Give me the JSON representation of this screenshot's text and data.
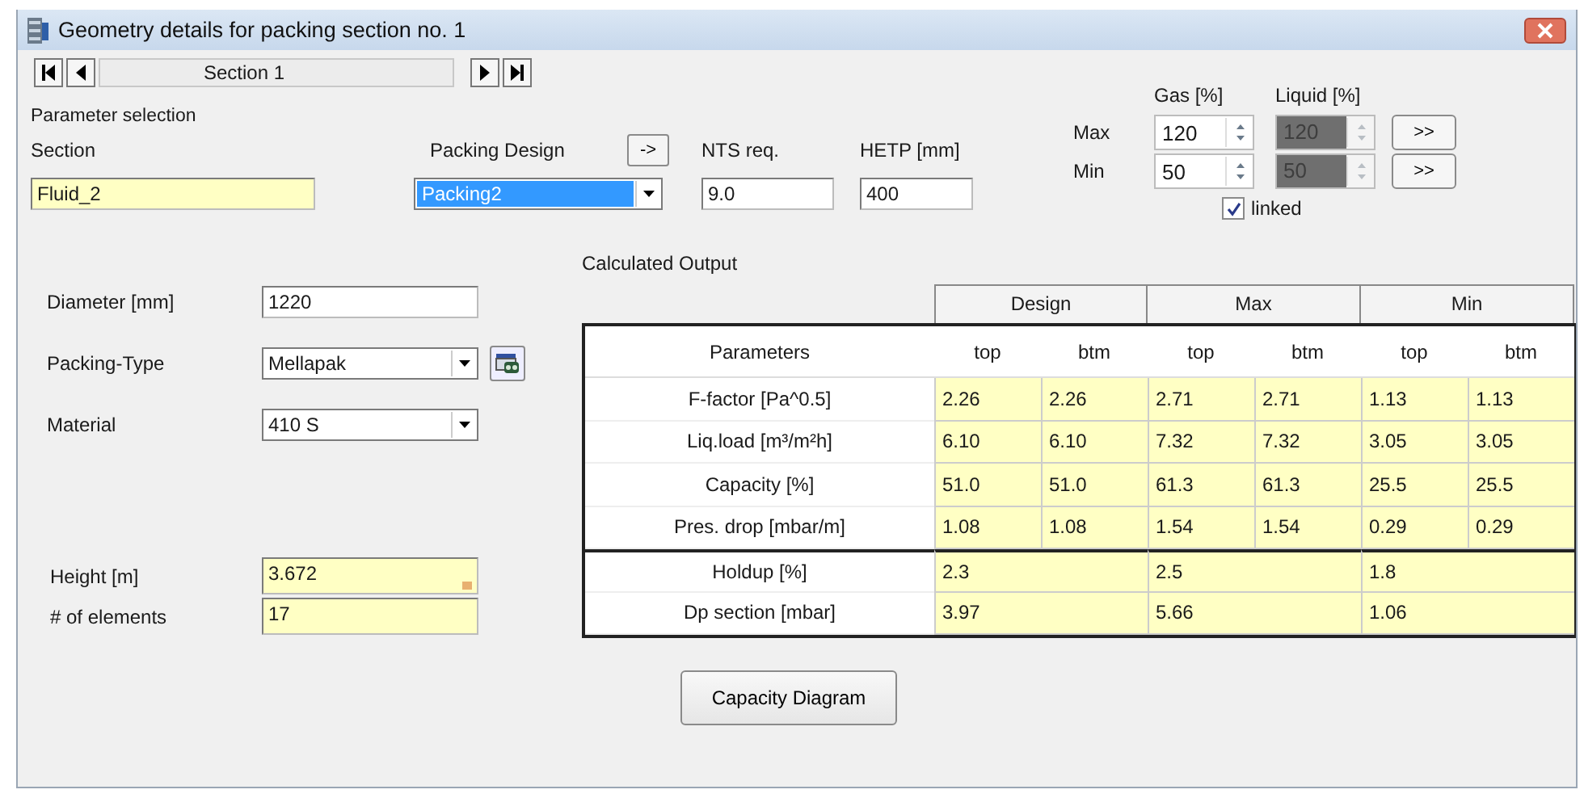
{
  "window": {
    "title": "Geometry details for packing section no. 1"
  },
  "navigator": {
    "section": "Section 1"
  },
  "parameter_selection": {
    "title": "Parameter selection",
    "section": {
      "label": "Section",
      "value": "Fluid_2",
      "highlighted": true
    },
    "packing_design": {
      "label": "Packing Design",
      "value": "Packing2",
      "button": "->",
      "text_selected": true
    },
    "nts_req": {
      "label": "NTS req.",
      "value": "9.0",
      "highlighted": false
    },
    "hetp": {
      "label": "HETP [mm]",
      "value": "400",
      "highlighted": false
    }
  },
  "ranges": {
    "gas_label": "Gas [%]",
    "liquid_label": "Liquid [%]",
    "rows": [
      {
        "label": "Max",
        "gas": "120",
        "liquid": "120",
        "liquid_disabled": true,
        "button": ">>"
      },
      {
        "label": "Min",
        "gas": "50",
        "liquid": "50",
        "liquid_disabled": true,
        "button": ">>"
      }
    ],
    "linked": {
      "label": "linked",
      "checked": true
    }
  },
  "geometry": [
    {
      "kind": "text",
      "label": "Diameter [mm]",
      "value": "1220",
      "highlighted": false
    },
    {
      "kind": "combo",
      "label": "Packing-Type",
      "value": "Mellapak",
      "lookup_button": true
    },
    {
      "kind": "combo",
      "label": "Material",
      "value": "410 S",
      "lookup_button": false
    }
  ],
  "height_fields": [
    {
      "label": "Height [m]",
      "value": "3.672",
      "highlighted": true,
      "marker": true
    },
    {
      "label": "# of elements",
      "value": "17",
      "highlighted": true,
      "marker": false
    }
  ],
  "output": {
    "title": "Calculated Output",
    "groups": [
      "Design",
      "Max",
      "Min"
    ],
    "param_header": "Parameters",
    "sub_headers": [
      "top",
      "btm",
      "top",
      "btm",
      "top",
      "btm"
    ],
    "rows": [
      {
        "label": "F-factor [Pa^0.5]",
        "values": [
          "2.26",
          "2.26",
          "2.71",
          "2.71",
          "1.13",
          "1.13"
        ]
      },
      {
        "label": "Liq.load [m³/m²h]",
        "values": [
          "6.10",
          "6.10",
          "7.32",
          "7.32",
          "3.05",
          "3.05"
        ]
      },
      {
        "label": "Capacity [%]",
        "values": [
          "51.0",
          "51.0",
          "61.3",
          "61.3",
          "25.5",
          "25.5"
        ]
      },
      {
        "label": "Pres. drop [mbar/m]",
        "values": [
          "1.08",
          "1.08",
          "1.54",
          "1.54",
          "0.29",
          "0.29"
        ]
      }
    ],
    "summary_rows": [
      {
        "label": "Holdup [%]",
        "values": [
          "2.3",
          "2.5",
          "1.8"
        ]
      },
      {
        "label": "Dp section [mbar]",
        "values": [
          "3.97",
          "5.66",
          "1.06"
        ]
      }
    ]
  },
  "buttons": [
    "Capacity Diagram"
  ]
}
